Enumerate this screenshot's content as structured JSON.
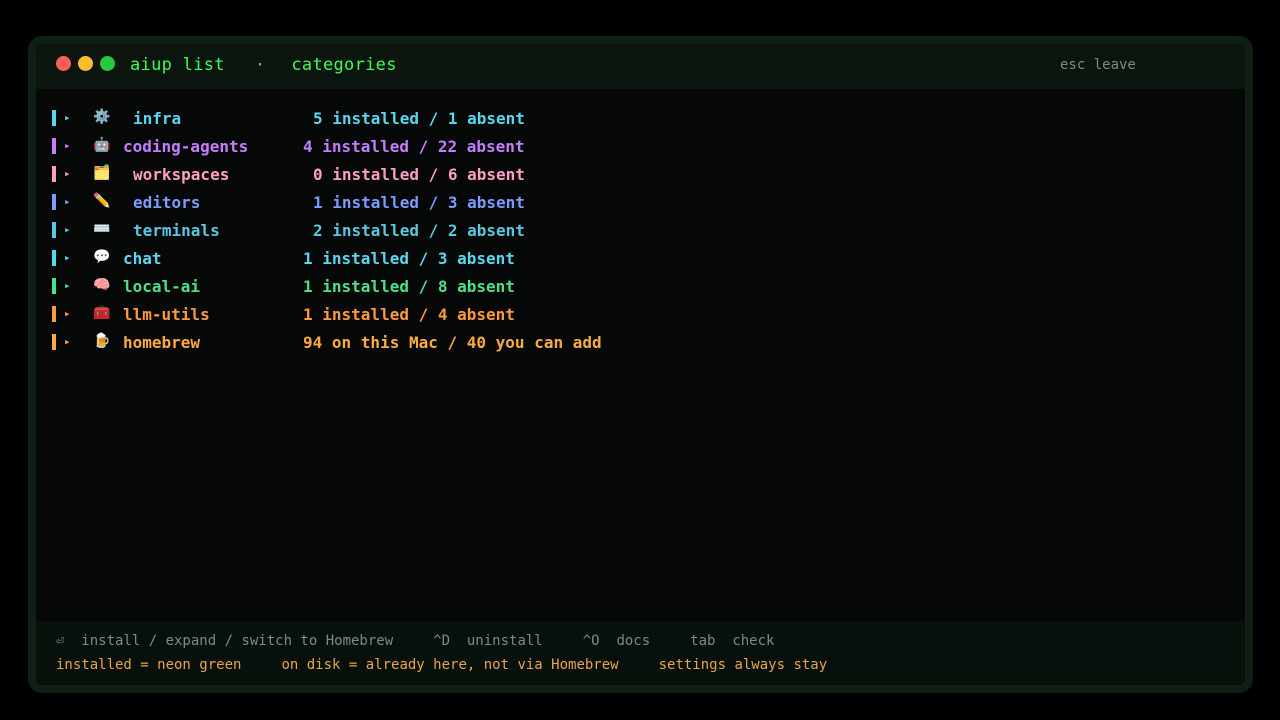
{
  "titlebar": {
    "command": "aiup list",
    "separator": "·",
    "view": "categories",
    "esc_hint": "esc leave"
  },
  "categories": [
    {
      "icon": "⚙️",
      "name": "infra",
      "count": "5 installed / 1 absent",
      "color": "#5ad7f0"
    },
    {
      "icon": "🤖",
      "name": "coding-agents",
      "count": "4 installed / 22 absent",
      "color": "#c77dff"
    },
    {
      "icon": "🗂️",
      "name": "workspaces",
      "count": "0 installed / 6 absent",
      "color": "#ff9ecb"
    },
    {
      "icon": "✏️",
      "name": "editors",
      "count": "1 installed / 3 absent",
      "color": "#7d9cff"
    },
    {
      "icon": "⌨️",
      "name": "terminals",
      "count": "2 installed / 2 absent",
      "color": "#5ac8e0"
    },
    {
      "icon": "💬",
      "name": "chat",
      "count": "1 installed / 3 absent",
      "color": "#5ad7f0"
    },
    {
      "icon": "🧠",
      "name": "local-ai",
      "count": "1 installed / 8 absent",
      "color": "#4de08a"
    },
    {
      "icon": "🧰",
      "name": "llm-utils",
      "count": "1 installed / 4 absent",
      "color": "#ff9a3c"
    },
    {
      "icon": "🍺",
      "name": "homebrew",
      "count": "94 on this Mac / 40 you can add",
      "color": "#ffaa40"
    }
  ],
  "footer": {
    "keys": [
      "⏎  install / expand / switch to Homebrew",
      "^D  uninstall",
      "^O  docs",
      "tab  check"
    ],
    "legend": [
      "installed = neon green",
      "on disk = already here, not via Homebrew",
      "settings always stay"
    ]
  }
}
